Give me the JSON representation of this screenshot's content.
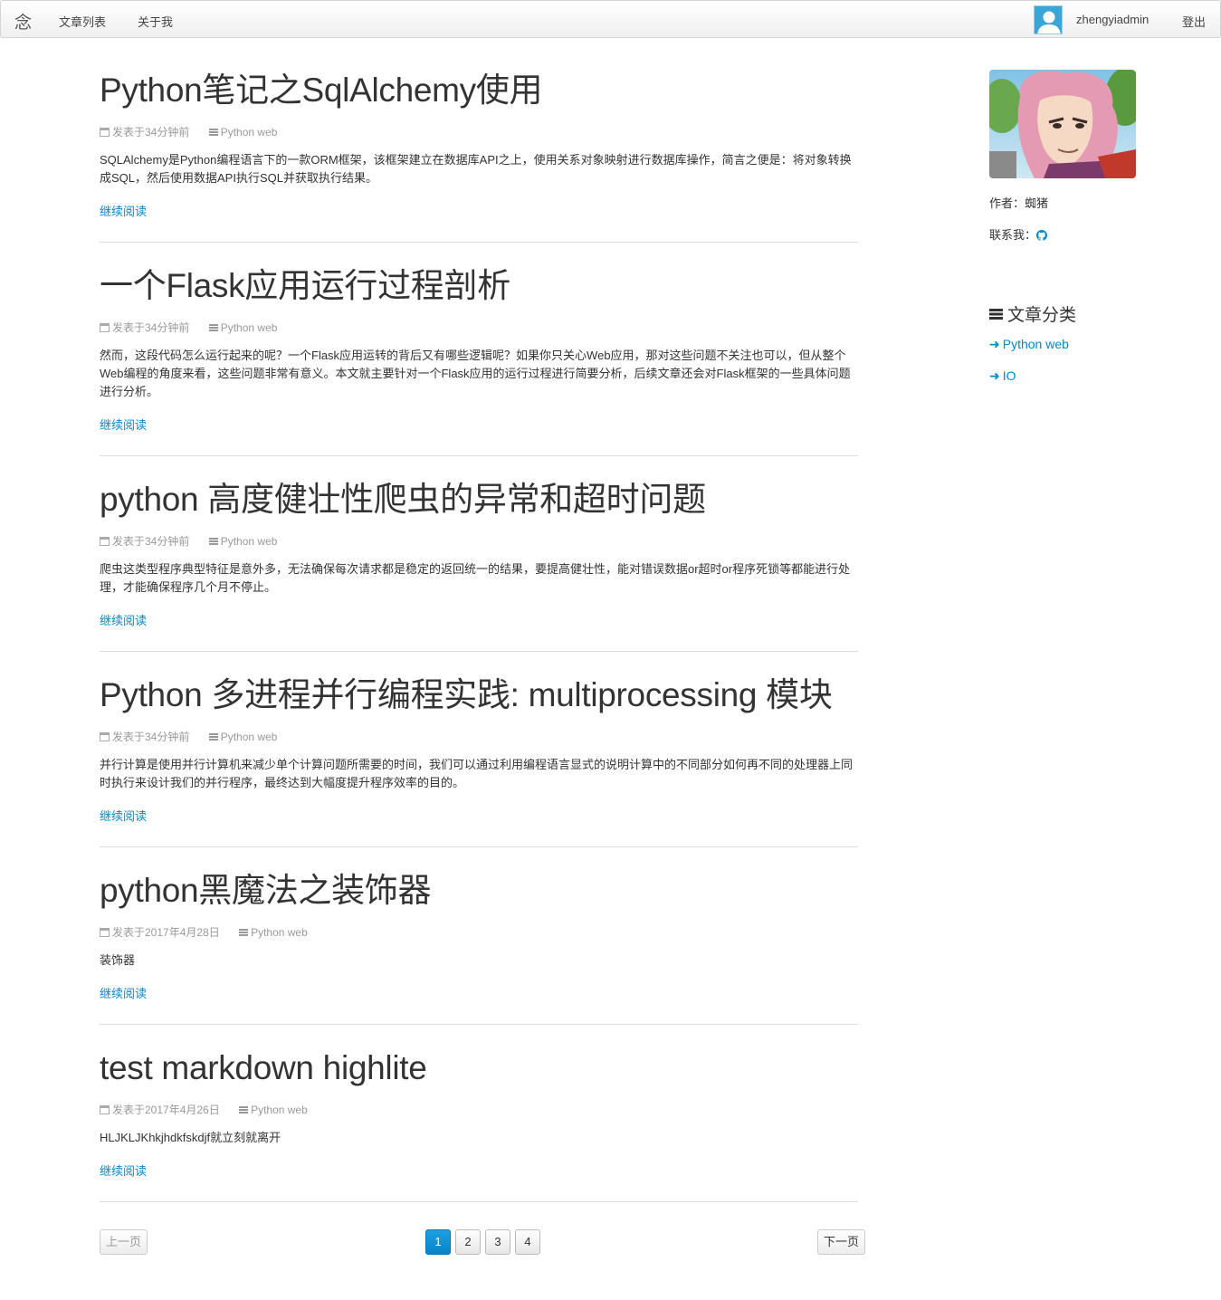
{
  "navbar": {
    "brand": "念",
    "links": [
      "文章列表",
      "关于我"
    ],
    "username": "zhengyiadmin",
    "logout": "登出"
  },
  "posts": [
    {
      "title": "Python笔记之SqlAlchemy使用",
      "meta_date": "发表于34分钟前",
      "meta_category": "Python web",
      "excerpt": "SQLAlchemy是Python编程语言下的一款ORM框架，该框架建立在数据库API之上，使用关系对象映射进行数据库操作，简言之便是：将对象转换成SQL，然后使用数据API执行SQL并获取执行结果。",
      "read_more": "继续阅读"
    },
    {
      "title": "一个Flask应用运行过程剖析",
      "meta_date": "发表于34分钟前",
      "meta_category": "Python web",
      "excerpt": "然而，这段代码怎么运行起来的呢？一个Flask应用运转的背后又有哪些逻辑呢？如果你只关心Web应用，那对这些问题不关注也可以，但从整个Web编程的角度来看，这些问题非常有意义。本文就主要针对一个Flask应用的运行过程进行简要分析，后续文章还会对Flask框架的一些具体问题进行分析。",
      "read_more": "继续阅读"
    },
    {
      "title": "python 高度健壮性爬虫的异常和超时问题",
      "meta_date": "发表于34分钟前",
      "meta_category": "Python web",
      "excerpt": "爬虫这类型程序典型特征是意外多，无法确保每次请求都是稳定的返回统一的结果，要提高健壮性，能对错误数据or超时or程序死锁等都能进行处理，才能确保程序几个月不停止。",
      "read_more": "继续阅读"
    },
    {
      "title": "Python 多进程并行编程实践: multiprocessing 模块",
      "meta_date": "发表于34分钟前",
      "meta_category": "Python web",
      "excerpt": "并行计算是使用并行计算机来减少单个计算问题所需要的时间，我们可以通过利用编程语言显式的说明计算中的不同部分如何再不同的处理器上同时执行来设计我们的并行程序，最终达到大幅度提升程序效率的目的。",
      "read_more": "继续阅读"
    },
    {
      "title": "python黑魔法之装饰器",
      "meta_date": "发表于2017年4月28日",
      "meta_category": "Python web",
      "excerpt": "装饰器",
      "read_more": "继续阅读"
    },
    {
      "title": "test markdown highlite",
      "meta_date": "发表于2017年4月26日",
      "meta_category": "Python web",
      "excerpt": "HLJKLJKhkjhdkfskdjf就立刻就离开",
      "read_more": "继续阅读"
    }
  ],
  "pagination": {
    "prev": "上一页",
    "next": "下一页",
    "pages": [
      "1",
      "2",
      "3",
      "4"
    ],
    "current": "1"
  },
  "sidebar": {
    "author": "作者：蜘猪",
    "contact": "联系我：",
    "contact_icon": "github-icon",
    "categories_title": "文章分类",
    "categories": [
      "Python web",
      "IO"
    ]
  },
  "colors": {
    "link": "#0088cc",
    "active_page": "#0a82c8",
    "avatar_bg": "#3aa6d8"
  }
}
